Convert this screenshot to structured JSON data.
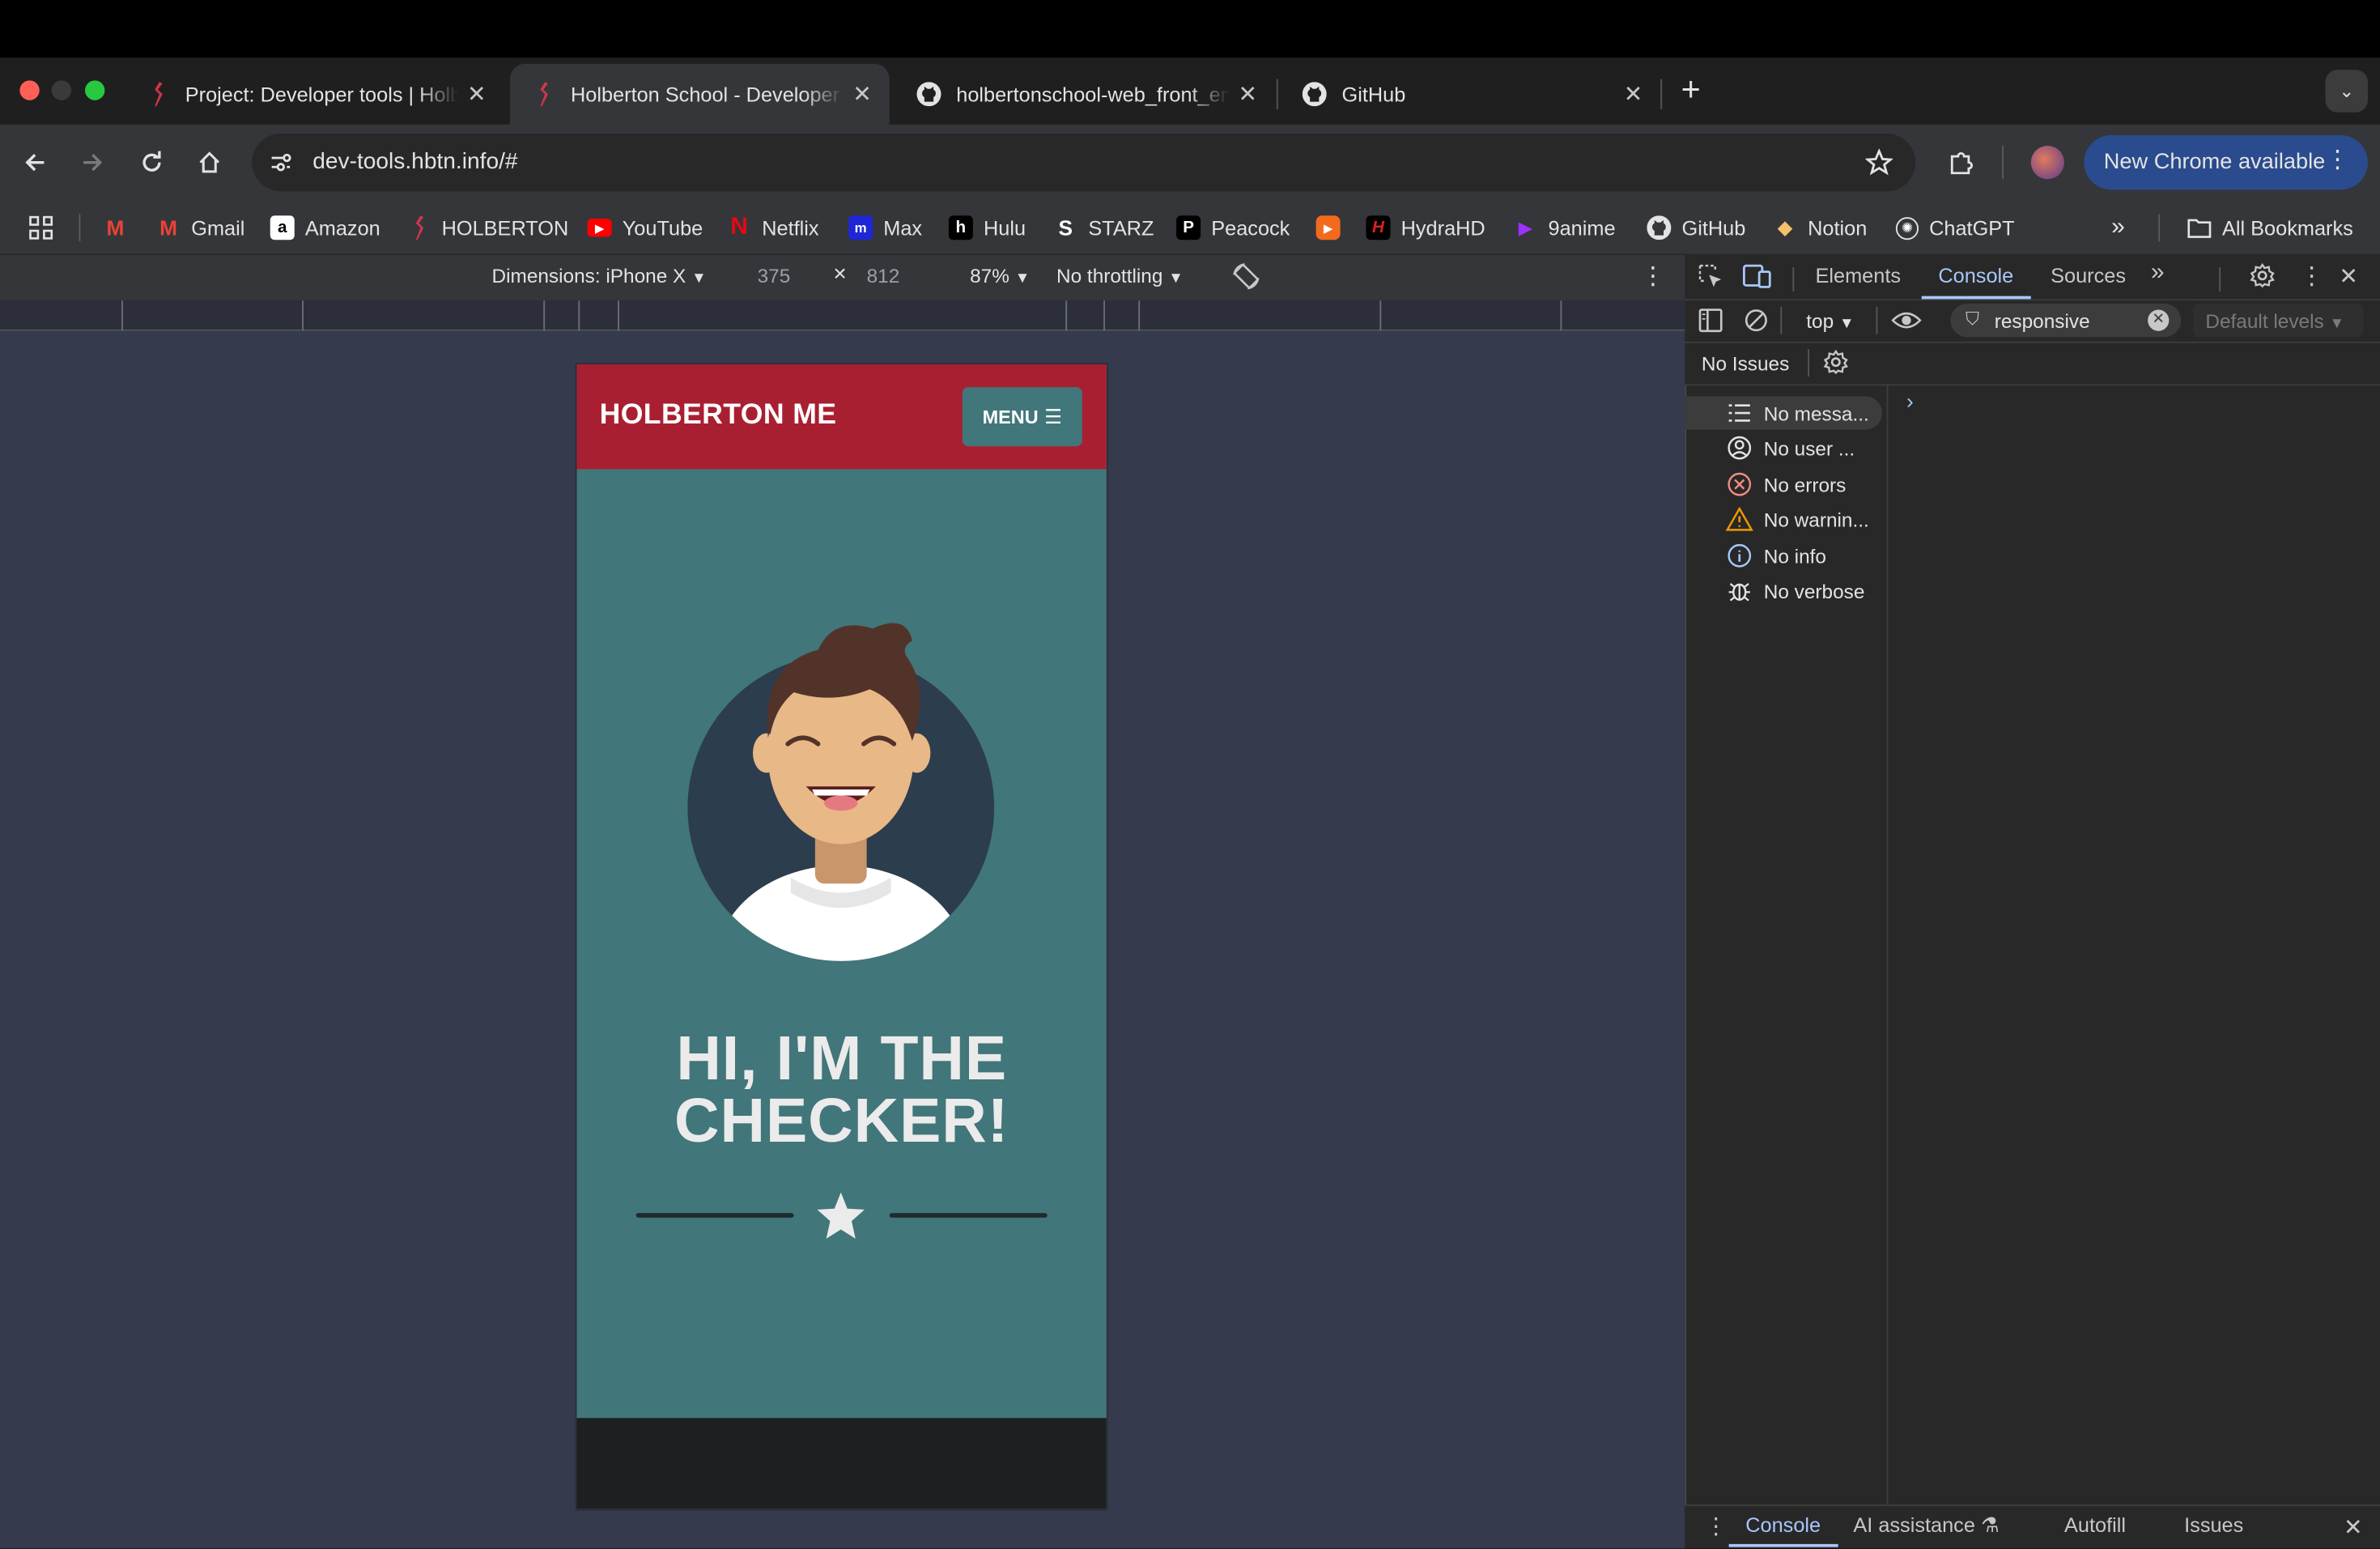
{
  "browser": {
    "tabs": [
      {
        "title": "Project: Developer tools | Holberton",
        "active": false
      },
      {
        "title": "Holberton School - Developer tools",
        "active": true
      },
      {
        "title": "holbertonschool-web_front_end",
        "active": false
      },
      {
        "title": "GitHub",
        "active": false
      }
    ],
    "url": "dev-tools.hbtn.info/#",
    "update_button": "New Chrome available",
    "bookmarks": [
      "Gmail",
      "Amazon",
      "HOLBERTON",
      "YouTube",
      "Netflix",
      "Max",
      "Hulu",
      "STARZ",
      "Peacock",
      "",
      "HydraHD",
      "9anime",
      "GitHub",
      "Notion",
      "ChatGPT"
    ],
    "all_bookmarks": "All Bookmarks"
  },
  "device_toolbar": {
    "dimensions": "Dimensions: iPhone X",
    "width": "375",
    "times": "×",
    "height": "812",
    "zoom": "87%",
    "throttling": "No throttling"
  },
  "page": {
    "brand": "HOLBERTON ME",
    "menu_label": "MENU",
    "hero_line1": "HI, I'M THE",
    "hero_line2": "CHECKER!"
  },
  "devtools": {
    "tabs": [
      "Elements",
      "Console",
      "Sources"
    ],
    "active_tab": "Console",
    "context": "top",
    "filter_value": "responsive",
    "levels": "Default levels",
    "issues": "No Issues",
    "sidebar": [
      {
        "label": "No messa...",
        "icon": "list-icon"
      },
      {
        "label": "No user ...",
        "icon": "user-icon"
      },
      {
        "label": "No errors",
        "icon": "error-icon"
      },
      {
        "label": "No warnin...",
        "icon": "warning-icon"
      },
      {
        "label": "No info",
        "icon": "info-icon"
      },
      {
        "label": "No verbose",
        "icon": "bug-icon"
      }
    ],
    "drawer_tabs": [
      "Console",
      "AI assistance",
      "Autofill",
      "Issues"
    ]
  },
  "colors": {
    "header_red": "#a91f32",
    "teal": "#41767a",
    "viewport_bg": "#353a4c",
    "chrome_blue": "#2a4b8d",
    "devtools_accent": "#a8c7fa"
  }
}
